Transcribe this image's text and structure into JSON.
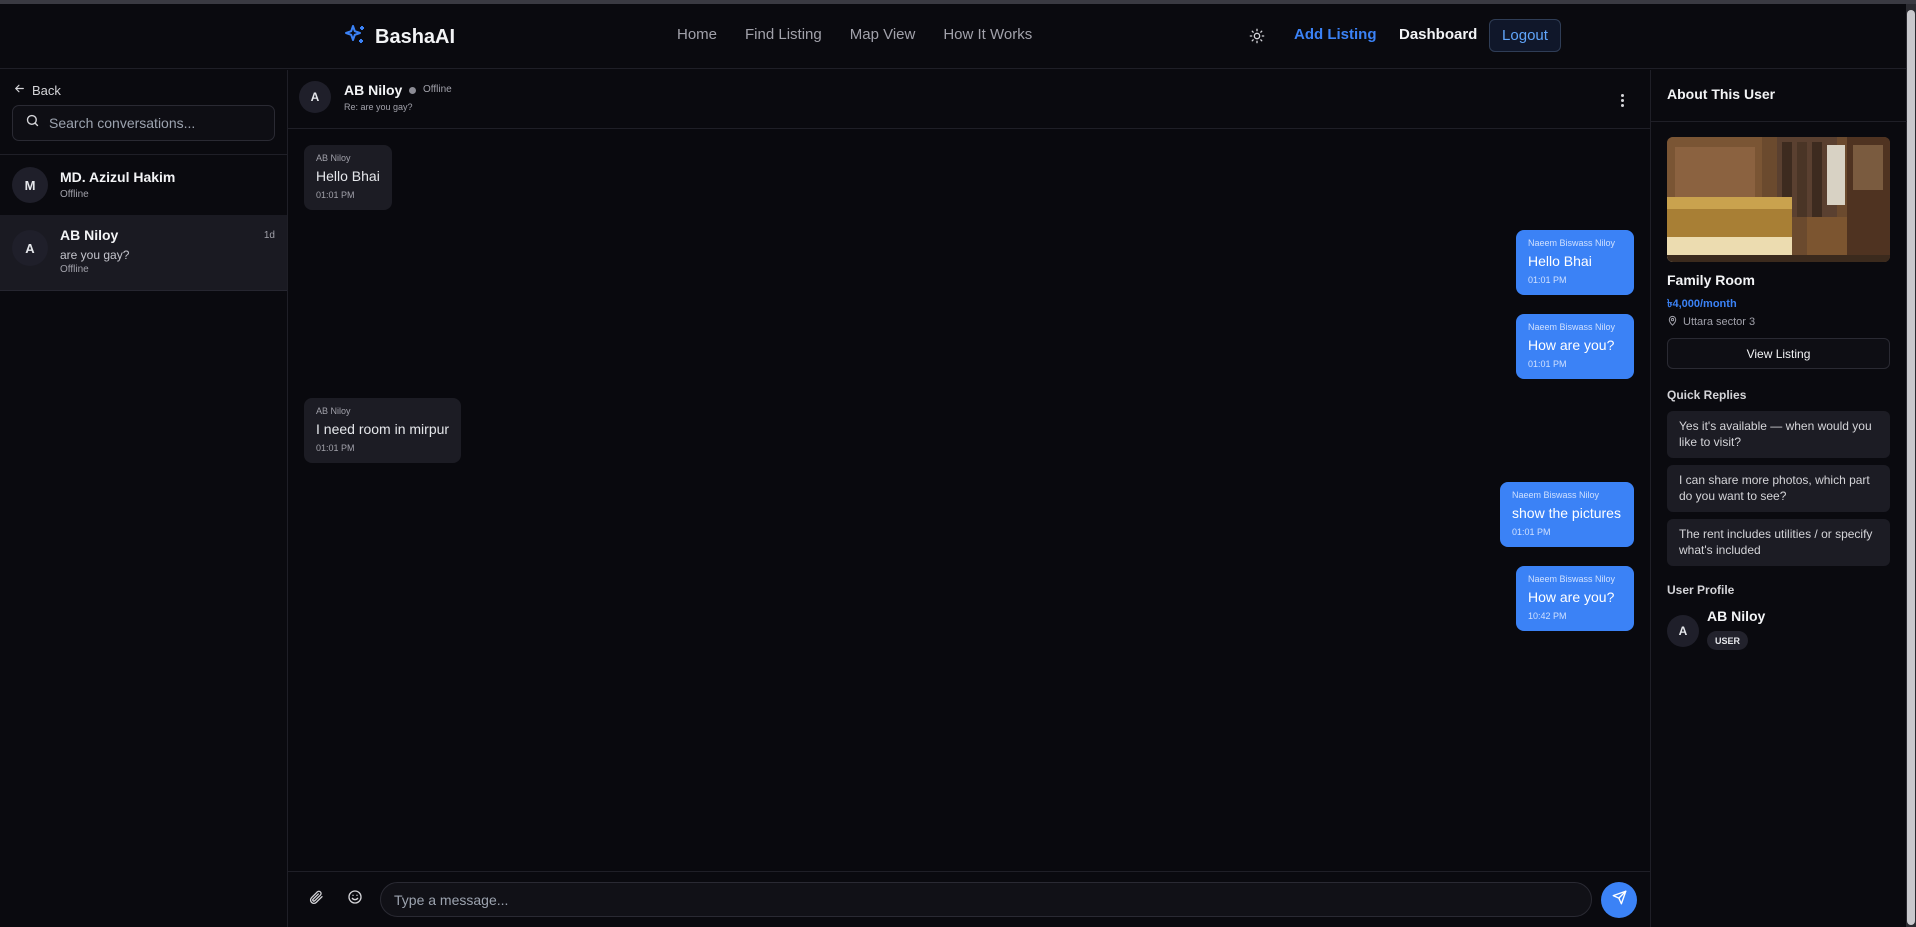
{
  "header": {
    "brand": "BashaAI",
    "nav": [
      "Home",
      "Find Listing",
      "Map View",
      "How It Works"
    ],
    "add_listing": "Add Listing",
    "dashboard": "Dashboard",
    "logout": "Logout"
  },
  "sidebar": {
    "back": "Back",
    "search_placeholder": "Search conversations...",
    "conversations": [
      {
        "initial": "M",
        "name": "MD. Azizul Hakim",
        "status": "Offline"
      },
      {
        "initial": "A",
        "name": "AB Niloy",
        "last_message": "are you gay?",
        "status": "Offline",
        "time": "1d"
      }
    ]
  },
  "chat": {
    "initial": "A",
    "name": "AB Niloy",
    "status": "Offline",
    "subject": "Re: are you gay?",
    "messages": [
      {
        "sender": "AB Niloy",
        "text": "Hello Bhai",
        "time": "01:01 PM",
        "direction": "in"
      },
      {
        "sender": "Naeem Biswass Niloy",
        "text": "Hello Bhai",
        "time": "01:01 PM",
        "direction": "out"
      },
      {
        "sender": "Naeem Biswass Niloy",
        "text": "How are you?",
        "time": "01:01 PM",
        "direction": "out"
      },
      {
        "sender": "AB Niloy",
        "text": "I need room in mirpur",
        "time": "01:01 PM",
        "direction": "in"
      },
      {
        "sender": "Naeem Biswass Niloy",
        "text": "show the pictures",
        "time": "01:01 PM",
        "direction": "out"
      },
      {
        "sender": "Naeem Biswass Niloy",
        "text": "How are you?",
        "time": "10:42 PM",
        "direction": "out"
      }
    ],
    "input_placeholder": "Type a message..."
  },
  "right": {
    "title": "About This User",
    "listing_title": "Family Room",
    "listing_price": "৳4,000/month",
    "listing_location": "Uttara sector 3",
    "view_listing": "View Listing",
    "quick_replies_title": "Quick Replies",
    "quick_replies": [
      "Yes it's available — when would you like to visit?",
      "I can share more photos, which part do you want to see?",
      "The rent includes utilities / or specify what's included"
    ],
    "user_profile_title": "User Profile",
    "user_initial": "A",
    "user_name": "AB Niloy",
    "user_role": "USER"
  },
  "colors": {
    "accent": "#3b82f6",
    "background": "#0a0a0f",
    "bubble_in": "#1c1c24"
  }
}
